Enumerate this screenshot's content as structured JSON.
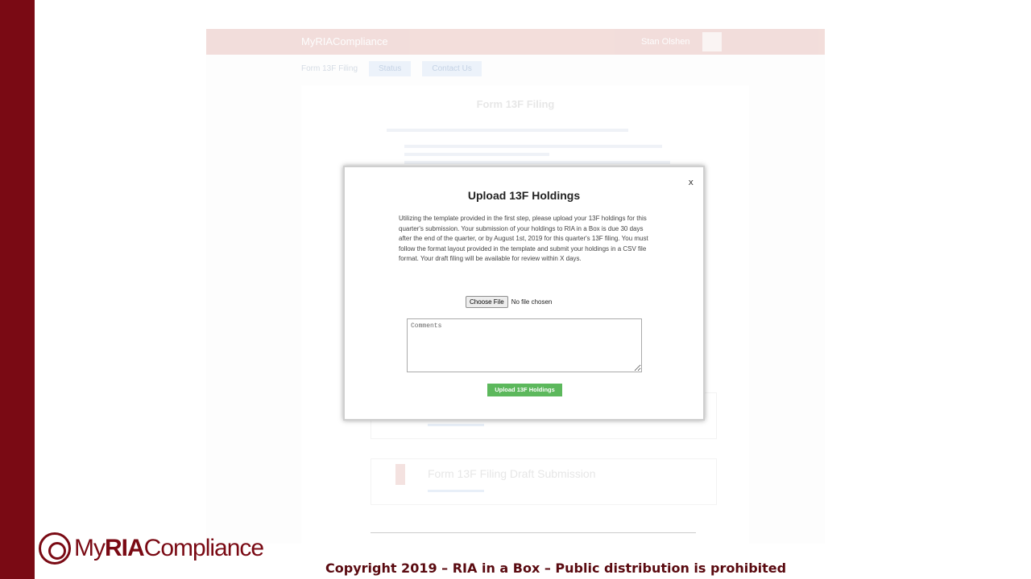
{
  "background": {
    "logo_text": "MyRIACompliance",
    "user_name": "Stan Olshen",
    "subnav": [
      "Form 13F Filing",
      "Status",
      "Contact Us"
    ],
    "page_title": "Form 13F Filing",
    "cards": [
      "",
      "Form 13F Filing Draft Submission"
    ]
  },
  "modal": {
    "title": "Upload 13F Holdings",
    "close_label": "x",
    "description": "Utilizing the template provided in the first step, please upload your 13F holdings for this quarter's submission. Your submission of your holdings to RIA in a Box is due 30 days after the end of the quarter, or by August 1st, 2019 for this quarter's 13F filing. You must follow the format layout provided in the template and submit your holdings in a CSV file format. Your draft filing will be available for review within X days.",
    "file_button": "Choose File",
    "file_status": "No file chosen",
    "comments_placeholder": "Comments",
    "upload_button": "Upload 13F Holdings"
  },
  "footer": {
    "brand_prefix": "My",
    "brand_bold": "RIA",
    "brand_suffix": "Compliance",
    "copyright": "Copyright 2019 – RIA in a Box – Public distribution is prohibited"
  },
  "colors": {
    "brand": "#7a0a14",
    "upload_button": "#5cb85c"
  }
}
